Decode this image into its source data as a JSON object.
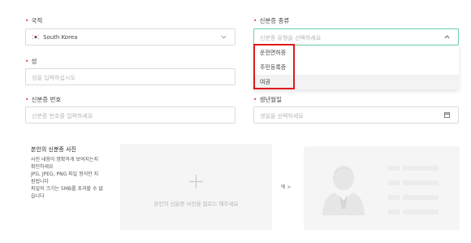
{
  "form": {
    "required_mark": "•",
    "nationality": {
      "label": "국적",
      "value": "South Korea",
      "flag_icon": "korea-flag-icon"
    },
    "id_type": {
      "label": "신분증 종류",
      "placeholder": "신분증 유형을 선택하세요"
    },
    "last_name": {
      "label": "성",
      "placeholder": "성을 입력하십시오"
    },
    "id_number": {
      "label": "신분증 번호",
      "placeholder": "신분증 번호를 입력하세요"
    },
    "birth_date": {
      "label": "생년월일",
      "placeholder": "생일을 선택하세요"
    },
    "dropdown_options": [
      "운전면허증",
      "주민등록증",
      "여권"
    ]
  },
  "photo": {
    "title": "본인의 신분증 사진",
    "desc_lines": [
      "사진 내용이 명확하게 보여지는지",
      "확인하세요",
      "JPG, JPEG, PNG 파일 형식만 지",
      "원됩니다",
      "파일의 크기는 5MB를 초과할 수 없",
      "습니다"
    ],
    "upload_text": "본인의 신분증 사진을 업로드 해주세요",
    "example_label": "예 >"
  },
  "colors": {
    "required": "#e2453c",
    "highlight_border": "#e0191c",
    "active_border": "#6fd0a8"
  }
}
